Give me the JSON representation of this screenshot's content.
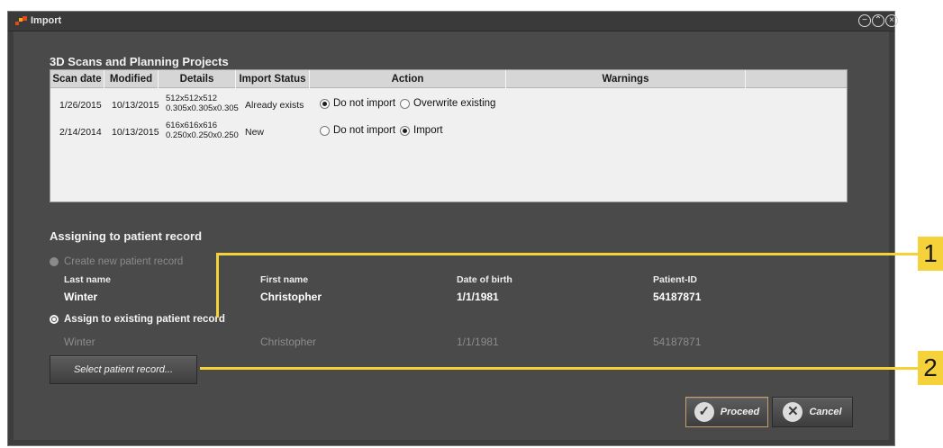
{
  "window": {
    "title": "Import",
    "controls": [
      "minimize",
      "restore",
      "close"
    ]
  },
  "scans_section": {
    "title": "3D Scans and Planning Projects"
  },
  "table": {
    "columns": [
      "Scan date",
      "Modified",
      "Details",
      "Import Status",
      "Action",
      "Warnings"
    ],
    "rows": [
      {
        "scan_date": "1/26/2015",
        "modified": "10/13/2015",
        "details_line1": "512x512x512",
        "details_line2": "0.305x0.305x0.305",
        "import_status": "Already exists",
        "action_options": [
          "Do not import",
          "Overwrite existing"
        ],
        "action_selected": "Do not import",
        "warnings": ""
      },
      {
        "scan_date": "2/14/2014",
        "modified": "10/13/2015",
        "details_line1": "616x616x616",
        "details_line2": "0.250x0.250x0.250",
        "import_status": "New",
        "action_options": [
          "Do not import",
          "Import"
        ],
        "action_selected": "Import",
        "warnings": ""
      }
    ]
  },
  "patient_section": {
    "title": "Assigning to patient record",
    "create_new_label": "Create new patient record",
    "assign_existing_label": "Assign to existing patient record",
    "headers": {
      "last_name": "Last name",
      "first_name": "First name",
      "dob": "Date of birth",
      "patient_id": "Patient-ID"
    },
    "current": {
      "last_name": "Winter",
      "first_name": "Christopher",
      "dob": "1/1/1981",
      "patient_id": "54187871"
    },
    "existing": {
      "last_name": "Winter",
      "first_name": "Christopher",
      "dob": "1/1/1981",
      "patient_id": "54187871"
    },
    "select_button": "Select patient record..."
  },
  "buttons": {
    "proceed": "Proceed",
    "cancel": "Cancel"
  },
  "callouts": {
    "one": "1",
    "two": "2"
  },
  "colors": {
    "callout": "#f5d23a",
    "window_bg": "#4a4a4a",
    "proceed_border": "#c9a06a"
  }
}
